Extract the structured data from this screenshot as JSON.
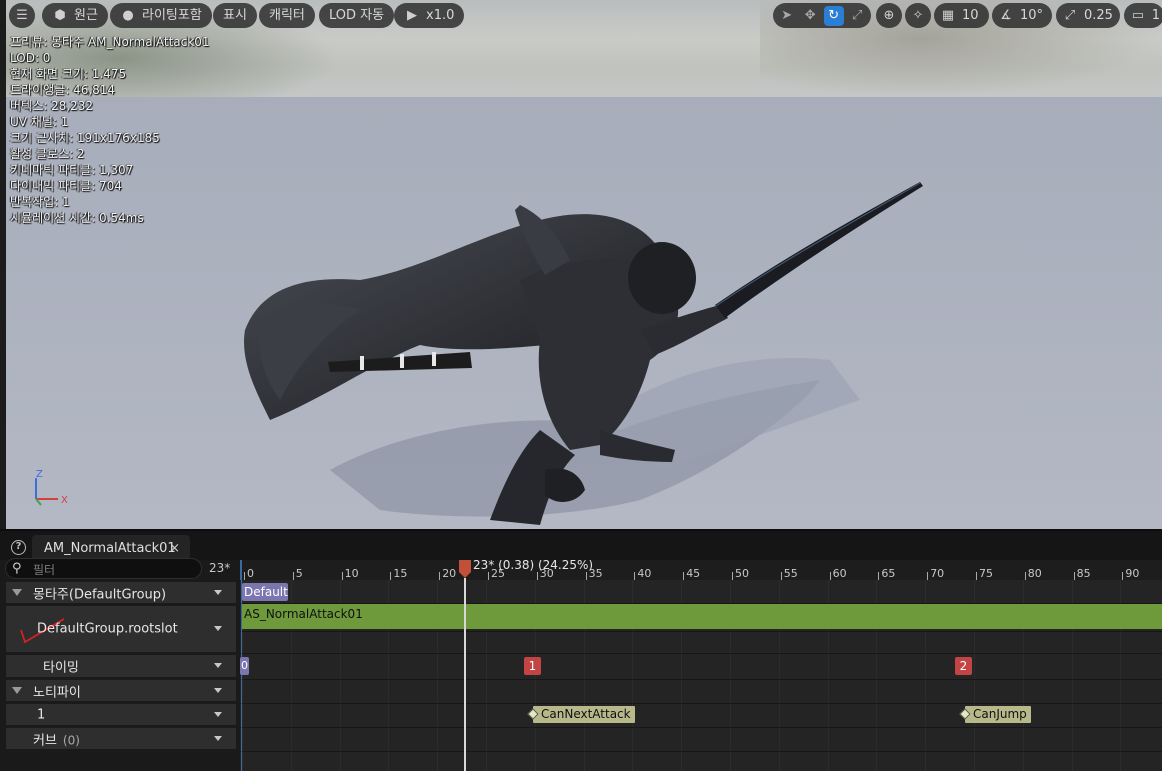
{
  "toolbar": {
    "perspective_label": "원근",
    "lighting_label": "라이팅포함",
    "show_label": "표시",
    "character_label": "캐릭터",
    "lod_label": "LOD 자동",
    "play_speed_label": "x1.0",
    "grid_snap_value": "10",
    "rotation_snap_value": "10°",
    "scale_snap_value": "0.25",
    "camera_speed_value": "1"
  },
  "stats": [
    "프리뷰: 몽타주 AM_NormalAttack01",
    "LOD: 0",
    "현재 화면 크기: 1.475",
    "트라이앵글: 46,814",
    "버텍스: 28,232",
    "UV 채널: 1",
    "크기 근사치: 191x176x185",
    "활성 클로스: 2",
    "키네마틱 파티클: 1,307",
    "다이내믹 파티클: 704",
    "반복작업: 1",
    "시뮬레이션 시간: 0.54ms"
  ],
  "gizmo": {
    "z": "Z",
    "x": "X"
  },
  "panel": {
    "tab_label": "AM_NormalAttack01",
    "tab_close": "×",
    "filter_placeholder": "필터",
    "frame_count": "23*"
  },
  "tracks": {
    "montage_group": "몽타주(DefaultGroup)",
    "slot_name": "DefaultGroup.rootslot",
    "timing": "타이밍",
    "notifies": "노티파이",
    "notify_track": "1",
    "curves": "커브",
    "curve_count": "(0)"
  },
  "timeline": {
    "scrub_label": "23* (0.38) (24.25%)",
    "ticks": [
      "0",
      "5",
      "10",
      "15",
      "20",
      "25",
      "30",
      "35",
      "40",
      "45",
      "50",
      "55",
      "60",
      "65",
      "70",
      "75",
      "80",
      "85",
      "90"
    ],
    "section_label": "Default",
    "segment_label": "AS_NormalAttack01",
    "timing_marks": [
      "0",
      "1",
      "2"
    ],
    "notifies": [
      "CanNextAttack",
      "CanJump"
    ]
  },
  "colors": {
    "accent": "#2a7fd4",
    "segment": "#6f9a3c",
    "section": "#7b75b0",
    "timing_mark": "#c24444",
    "notify": "#b8b98b"
  }
}
